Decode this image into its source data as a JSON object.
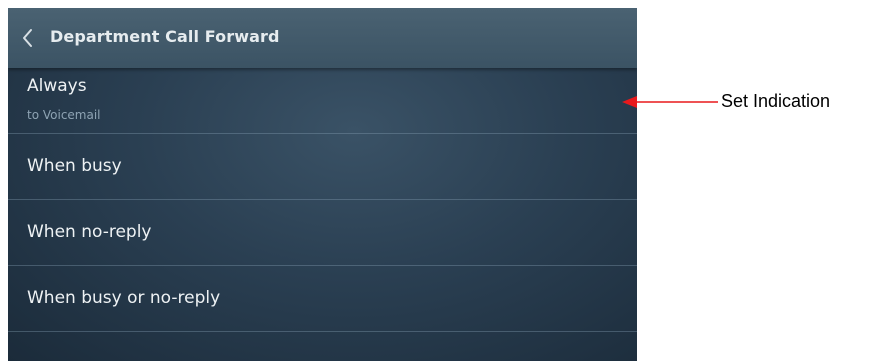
{
  "header": {
    "title": "Department Call Forward",
    "back_icon": "chevron-left-icon"
  },
  "list": {
    "items": [
      {
        "label": "Always",
        "sublabel": "to Voicemail",
        "set": true
      },
      {
        "label": "When busy"
      },
      {
        "label": "When no-reply"
      },
      {
        "label": "When busy or no-reply"
      }
    ]
  },
  "annotation": {
    "label": "Set Indication",
    "arrow_color": "#e8191c"
  },
  "colors": {
    "indicator": "#22d83a",
    "header_text": "#e6ecef",
    "sublabel_text": "#8ea3b3"
  }
}
